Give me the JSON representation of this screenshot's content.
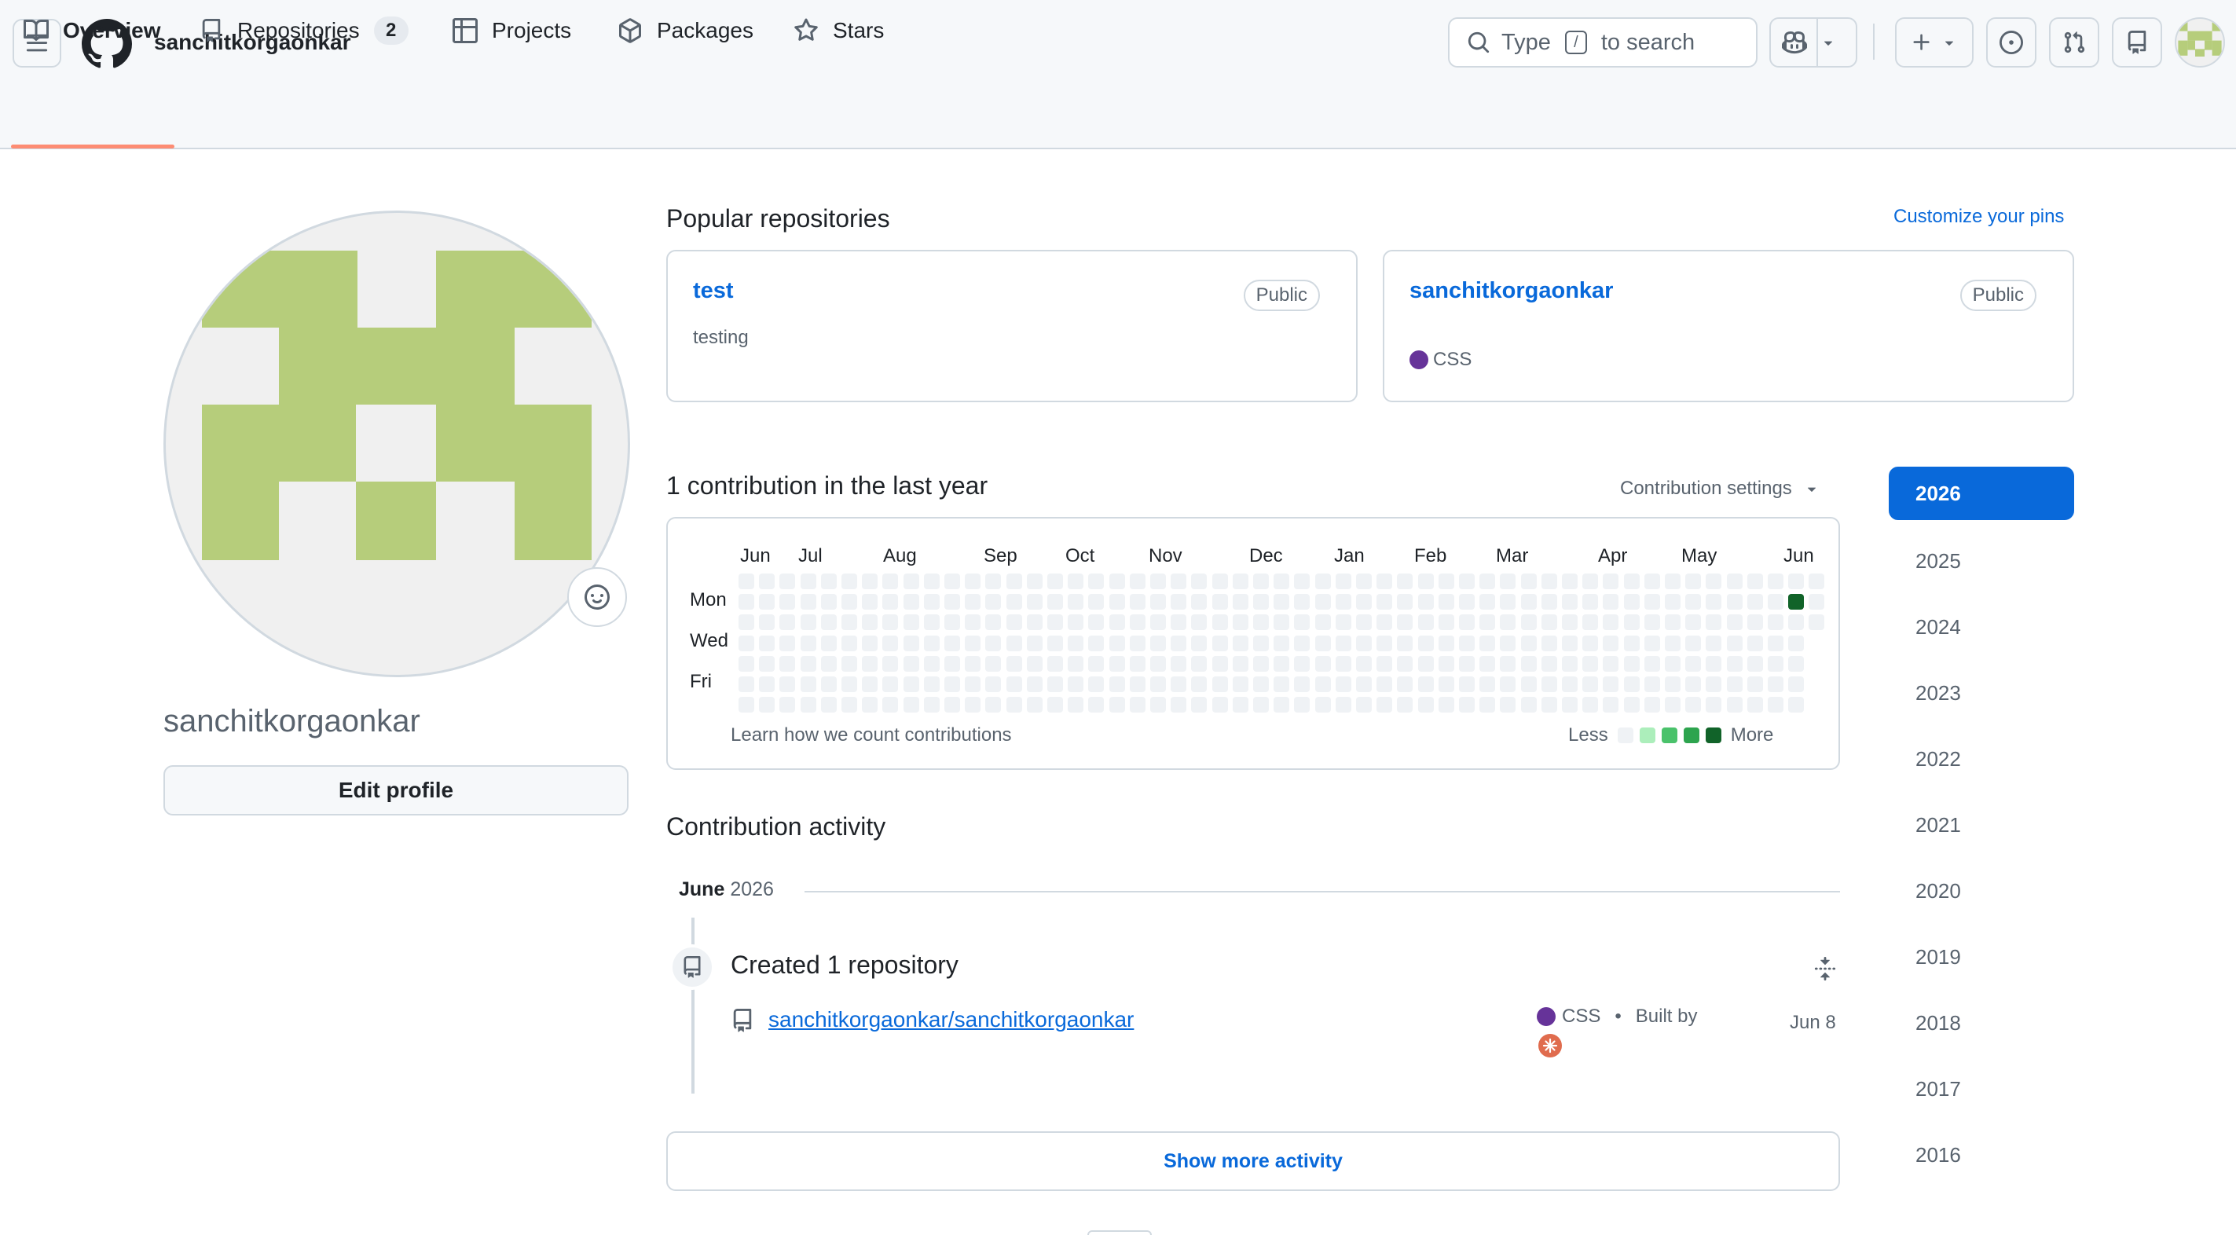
{
  "header": {
    "username": "sanchitkorgaonkar",
    "search": {
      "prefix": "Type",
      "key": "/",
      "suffix": "to search"
    }
  },
  "tabs": [
    {
      "label": "Overview",
      "icon": "book-icon",
      "selected": true
    },
    {
      "label": "Repositories",
      "icon": "repo-icon",
      "count": "2"
    },
    {
      "label": "Projects",
      "icon": "table-icon"
    },
    {
      "label": "Packages",
      "icon": "package-icon"
    },
    {
      "label": "Stars",
      "icon": "star-icon"
    }
  ],
  "sidebar": {
    "name": "sanchitkorgaonkar",
    "edit_profile_label": "Edit profile",
    "avatar_color": "#b6cd7b"
  },
  "popular": {
    "title": "Popular repositories",
    "customize_label": "Customize your pins",
    "repos": [
      {
        "name": "test",
        "visibility": "Public",
        "description": "testing",
        "language": ""
      },
      {
        "name": "sanchitkorgaonkar",
        "visibility": "Public",
        "description": "",
        "language": "CSS",
        "language_color": "#663399"
      }
    ]
  },
  "contributions": {
    "title": "1 contribution in the last year",
    "settings_label": "Contribution settings",
    "months": [
      "Jun",
      "Jul",
      "Aug",
      "Sep",
      "Oct",
      "Nov",
      "Dec",
      "Jan",
      "Feb",
      "Mar",
      "Apr",
      "May",
      "Jun"
    ],
    "days": [
      "Mon",
      "Wed",
      "Fri"
    ],
    "footer_link": "Learn how we count contributions",
    "legend_less": "Less",
    "legend_more": "More",
    "legend_colors": [
      "#eff2f5",
      "#aceebb",
      "#4ac26b",
      "#2da44e",
      "#116329"
    ],
    "active_cell_color": "#116329"
  },
  "years": [
    "2026",
    "2025",
    "2024",
    "2023",
    "2022",
    "2021",
    "2020",
    "2019",
    "2018",
    "2017",
    "2016"
  ],
  "activity": {
    "title": "Contribution activity",
    "month": "June",
    "year": "2026",
    "event_title": "Created 1 repository",
    "repo_full_name": "sanchitkorgaonkar/sanchitkorgaonkar",
    "language": "CSS",
    "built_by_label": "Built by",
    "date": "Jun 8",
    "show_more_label": "Show more activity"
  }
}
